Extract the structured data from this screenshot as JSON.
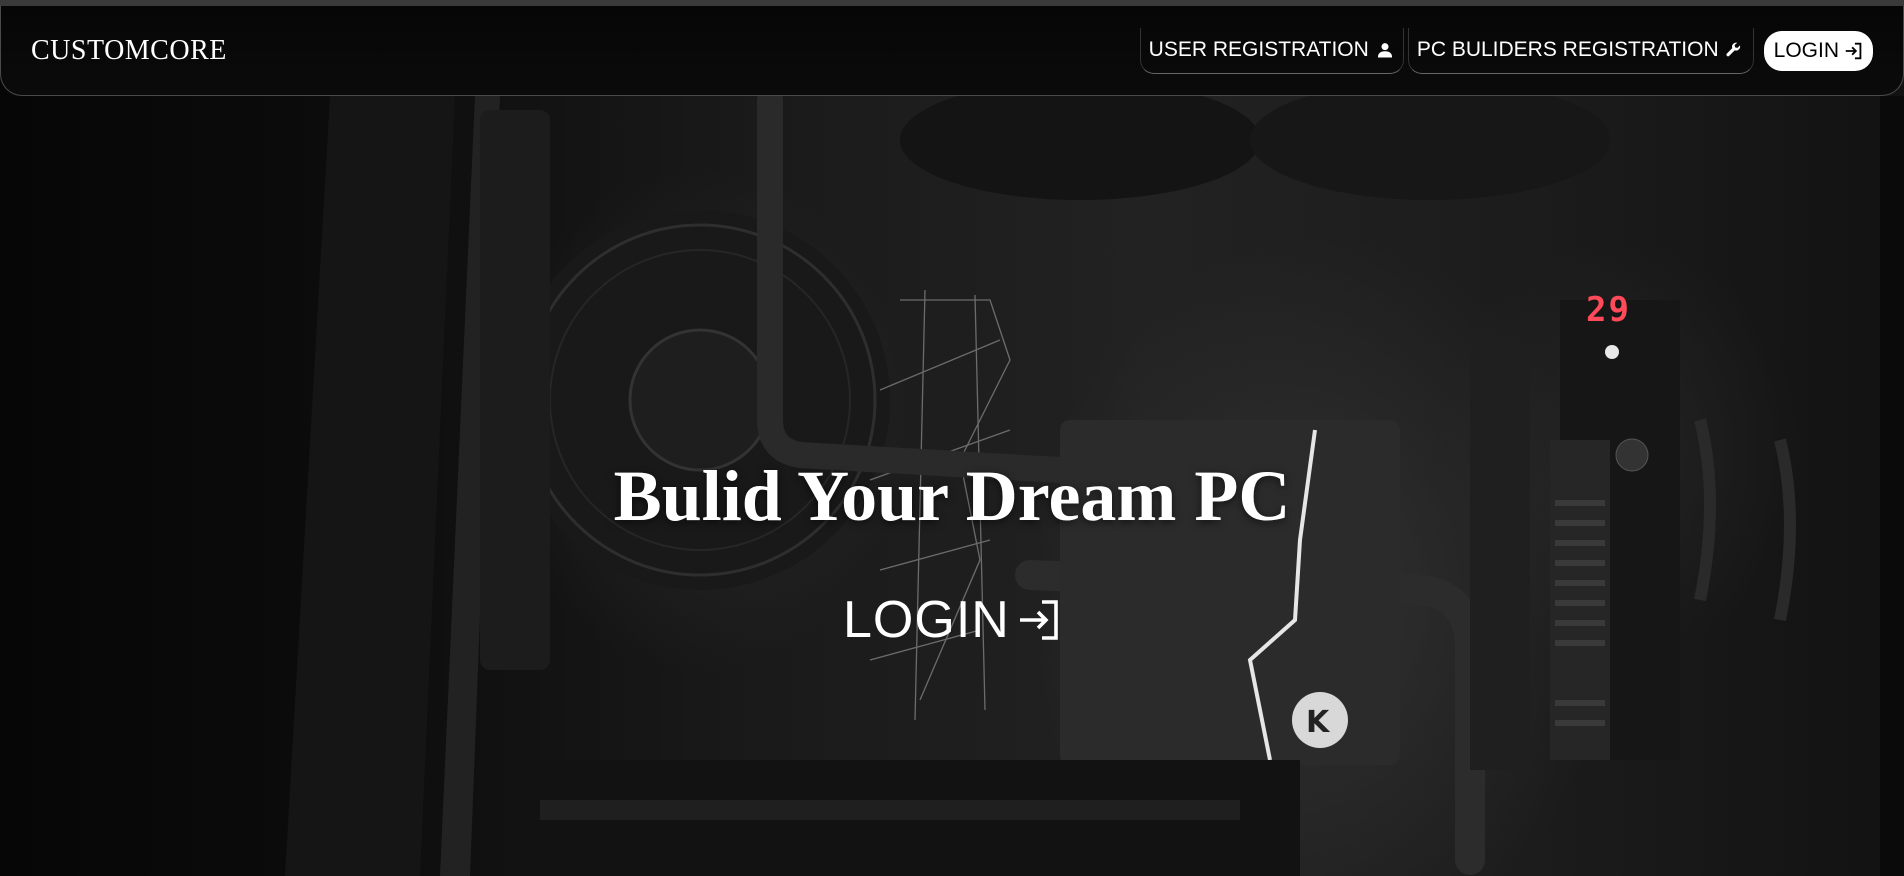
{
  "brand": "CUSTOMCORE",
  "nav": {
    "user_registration": "USER REGISTRATION",
    "builder_registration": "PC BULIDERS REGISTRATION",
    "login": "LOGIN"
  },
  "hero": {
    "title": "Bulid Your Dream PC",
    "login": "LOGIN",
    "temp_display": "29"
  },
  "icons": {
    "user": "person-icon",
    "builder": "wrench-icon",
    "login": "login-arrow-icon"
  },
  "colors": {
    "background": "#0a0a0a",
    "text": "#ffffff",
    "login_pill_bg": "#ffffff",
    "login_pill_text": "#000000",
    "led_display": "#ff4a5a"
  }
}
